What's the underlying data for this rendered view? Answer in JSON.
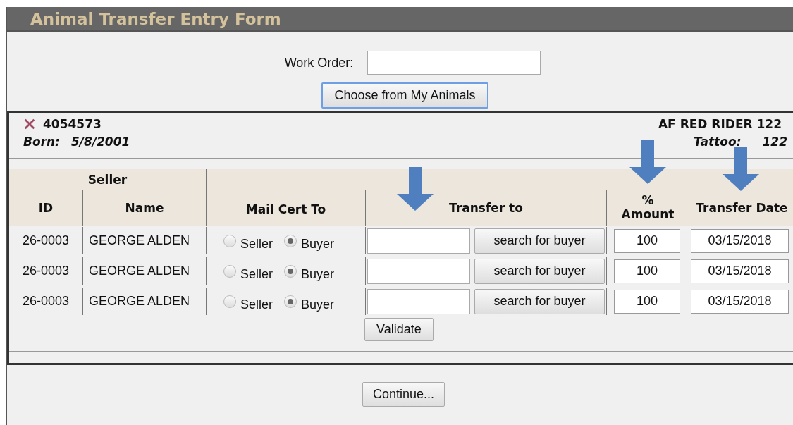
{
  "form": {
    "title": "Animal Transfer Entry Form",
    "work_order": {
      "label": "Work Order:"
    },
    "choose_button": "Choose from My Animals"
  },
  "animal": {
    "removable": true,
    "id": "4054573",
    "born_label": "Born:",
    "born": "5/8/2001",
    "name": "AF RED RIDER 122",
    "tattoo_label": "Tattoo:",
    "tattoo": "122"
  },
  "table": {
    "group_header": "Seller",
    "columns": [
      {
        "label": "ID",
        "arrow": false
      },
      {
        "label": "Name",
        "arrow": false
      },
      {
        "label": "Mail Cert To",
        "arrow": false
      },
      {
        "label": "Transfer to",
        "arrow": true
      },
      {
        "label": "% Amount",
        "arrow": true
      },
      {
        "label": "Transfer Date",
        "arrow": true
      }
    ],
    "rows": [
      {
        "id": "26-0003",
        "name": "GEORGE ALDEN",
        "mail_cert": [
          {
            "label": "Seller",
            "selected": false
          },
          {
            "label": "Buyer",
            "selected": true
          }
        ],
        "search_button": "search for buyer",
        "amount": "100",
        "date": "03/15/2018"
      },
      {
        "id": "26-0003",
        "name": "GEORGE ALDEN",
        "mail_cert": [
          {
            "label": "Seller",
            "selected": false
          },
          {
            "label": "Buyer",
            "selected": true
          }
        ],
        "search_button": "search for buyer",
        "amount": "100",
        "date": "03/15/2018"
      },
      {
        "id": "26-0003",
        "name": "GEORGE ALDEN",
        "mail_cert": [
          {
            "label": "Seller",
            "selected": false
          },
          {
            "label": "Buyer",
            "selected": true
          }
        ],
        "search_button": "search for buyer",
        "amount": "100",
        "date": "03/15/2018"
      }
    ]
  },
  "validate_button": "Validate",
  "continue_button": "Continue..."
}
